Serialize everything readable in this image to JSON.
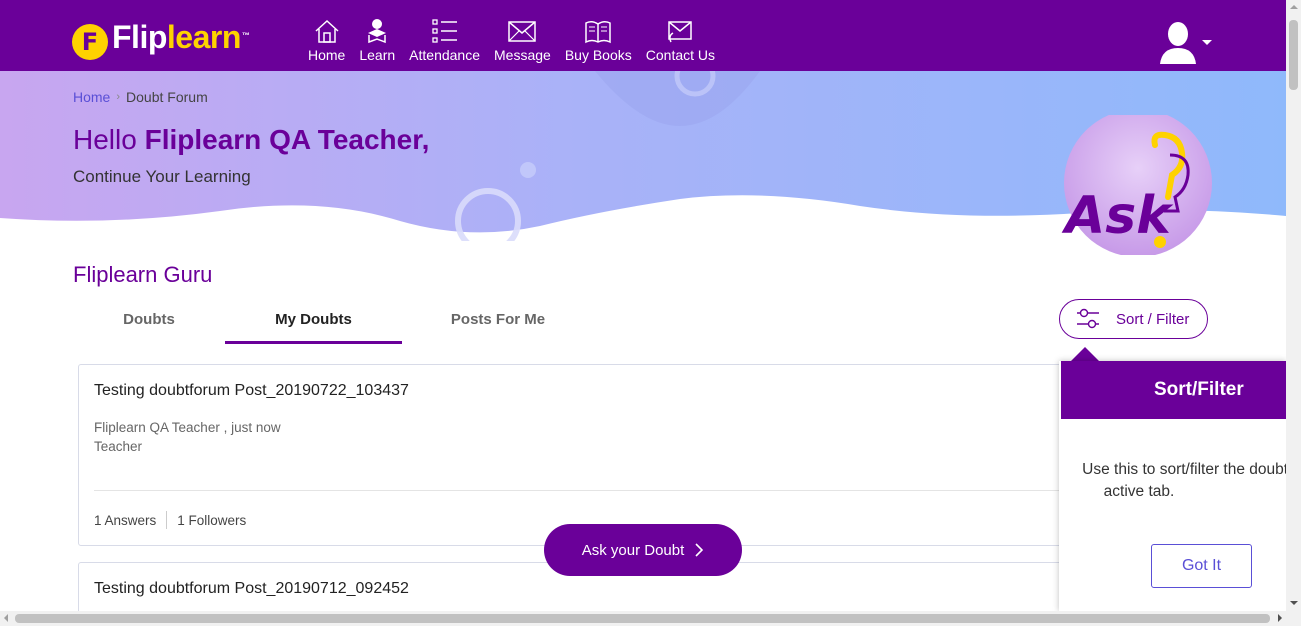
{
  "brand": {
    "name_white": "Flip",
    "name_yellow": "learn",
    "trademark": "™",
    "mark_letter": "F"
  },
  "nav": {
    "items": [
      {
        "label": "Home",
        "icon": "home-icon"
      },
      {
        "label": "Learn",
        "icon": "learn-icon"
      },
      {
        "label": "Attendance",
        "icon": "attendance-icon"
      },
      {
        "label": "Message",
        "icon": "message-icon"
      },
      {
        "label": "Buy Books",
        "icon": "books-icon"
      },
      {
        "label": "Contact Us",
        "icon": "contact-icon"
      }
    ]
  },
  "breadcrumb": {
    "home": "Home",
    "separator": "›",
    "current": "Doubt Forum"
  },
  "greeting": {
    "hello": "Hello ",
    "name": "Fliplearn QA Teacher,",
    "subtitle": "Continue Your Learning"
  },
  "section_title": "Fliplearn Guru",
  "tabs": [
    {
      "label": "Doubts",
      "active": false
    },
    {
      "label": "My Doubts",
      "active": true
    },
    {
      "label": "Posts For Me",
      "active": false
    }
  ],
  "sort_filter_button": "Sort / Filter",
  "posts": [
    {
      "title": "Testing doubtforum Post_20190722_103437",
      "author": "Fliplearn QA Teacher , just now",
      "role": "Teacher",
      "answers": "1 Answers",
      "followers": "1 Followers"
    },
    {
      "title": "Testing doubtforum Post_20190712_092452"
    }
  ],
  "ask_button": "Ask your Doubt",
  "popover": {
    "title": "Sort/Filter",
    "line1": "Use this to sort/filter the doubts",
    "line2": "active tab.",
    "button": "Got It"
  },
  "ask_logo_text": "Ask",
  "colors": {
    "primary": "#6a0099",
    "accent": "#ffd200",
    "link": "#5a4fd6"
  }
}
